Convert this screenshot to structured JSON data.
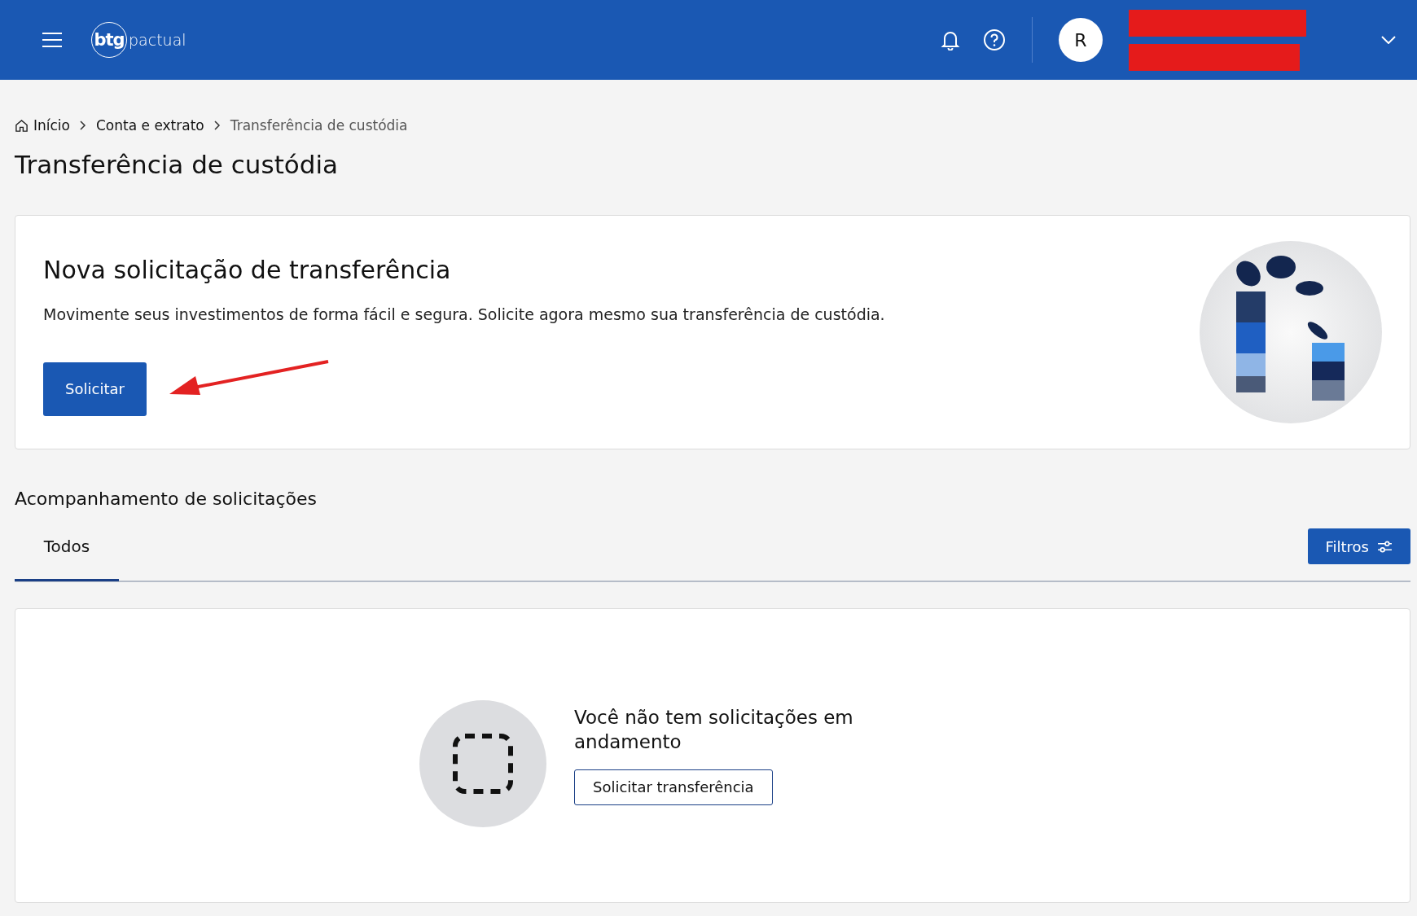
{
  "header": {
    "logo": {
      "mark": "btg",
      "word": "pactual"
    },
    "avatar": "R"
  },
  "breadcrumb": [
    {
      "label": "Início",
      "kind": "home"
    },
    {
      "label": "Conta e extrato",
      "kind": "link"
    },
    {
      "label": "Transferência de custódia",
      "kind": "current"
    }
  ],
  "page_title": "Transferência de custódia",
  "new_request": {
    "title": "Nova solicitação de transferência",
    "description": "Movimente seus investimentos de forma fácil e segura. Solicite agora mesmo sua transferência de custódia.",
    "button": "Solicitar"
  },
  "tracking": {
    "title": "Acompanhamento de solicitações",
    "tabs": [
      {
        "label": "Todos",
        "selected": true
      }
    ],
    "filter_button": "Filtros"
  },
  "empty_state": {
    "message": "Você não tem solicitações em andamento",
    "button": "Solicitar transferência"
  }
}
